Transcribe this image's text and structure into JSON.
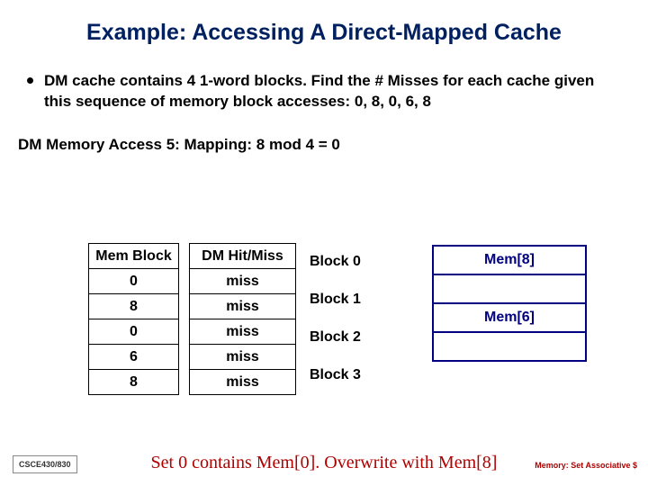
{
  "title": "Example: Accessing A Direct-Mapped Cache",
  "bullet": "DM cache contains 4 1-word blocks. Find the # Misses for each cache given this sequence of memory block accesses: 0, 8, 0, 6, 8",
  "subhead": "DM Memory Access 5:  Mapping: 8 mod 4 = 0",
  "memblk": {
    "header": "Mem Block",
    "rows": [
      "0",
      "8",
      "0",
      "6",
      "8"
    ]
  },
  "hitmiss": {
    "header": "DM Hit/Miss",
    "rows": [
      "miss",
      "miss",
      "miss",
      "miss",
      "miss"
    ]
  },
  "blockLabels": [
    "Block 0",
    "Block 1",
    "Block 2",
    "Block 3"
  ],
  "cache": [
    "Mem[8]",
    "",
    "Mem[6]",
    ""
  ],
  "caption": "Set 0 contains Mem[0]. Overwrite with Mem[8]",
  "course": "CSCE430/830",
  "footerNote": "Memory: Set Associative $"
}
